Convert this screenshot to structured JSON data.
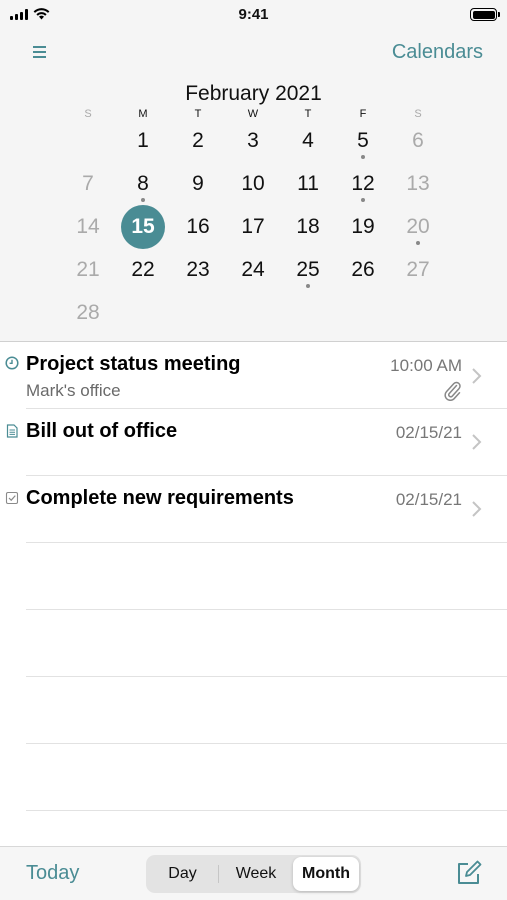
{
  "status_bar": {
    "time": "9:41"
  },
  "header": {
    "calendars_label": "Calendars",
    "month_title": "February 2021"
  },
  "weekdays": [
    "S",
    "M",
    "T",
    "W",
    "T",
    "F",
    "S"
  ],
  "calendar": {
    "weeks": [
      [
        "",
        "1",
        "2",
        "3",
        "4",
        "5",
        "6"
      ],
      [
        "7",
        "8",
        "9",
        "10",
        "11",
        "12",
        "13"
      ],
      [
        "14",
        "15",
        "16",
        "17",
        "18",
        "19",
        "20"
      ],
      [
        "21",
        "22",
        "23",
        "24",
        "25",
        "26",
        "27"
      ],
      [
        "28",
        "",
        "",
        "",
        "",
        "",
        ""
      ]
    ],
    "selected_day": "15",
    "days_with_events": [
      "5",
      "8",
      "12",
      "20",
      "25"
    ]
  },
  "events": [
    {
      "icon": "clock-icon",
      "title": "Project status meeting",
      "subtitle": "Mark's office",
      "time": "10:00 AM",
      "has_attachment": true
    },
    {
      "icon": "note-icon",
      "title": "Bill out of office",
      "time": "02/15/21"
    },
    {
      "icon": "checkbox-icon",
      "title": "Complete new requirements",
      "time": "02/15/21"
    }
  ],
  "tab_bar": {
    "today_label": "Today",
    "segments": [
      "Day",
      "Week",
      "Month"
    ],
    "active_segment": "Month"
  },
  "colors": {
    "accent": "#4a8c94",
    "weekend": "#aaaaaa",
    "background": "#f5f5f5"
  }
}
